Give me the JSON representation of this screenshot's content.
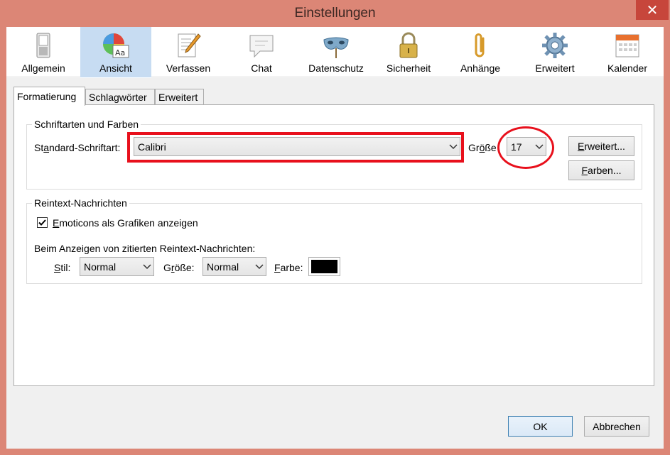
{
  "window": {
    "title": "Einstellungen",
    "close_symbol": "✕",
    "accent_color": "#dc8676"
  },
  "toolbar": {
    "items": [
      {
        "label": "Allgemein",
        "icon": "switch-icon"
      },
      {
        "label": "Ansicht",
        "icon": "palette-font-icon",
        "selected": true
      },
      {
        "label": "Verfassen",
        "icon": "compose-icon"
      },
      {
        "label": "Chat",
        "icon": "chat-bubble-icon"
      },
      {
        "label": "Datenschutz",
        "icon": "mask-icon"
      },
      {
        "label": "Sicherheit",
        "icon": "padlock-icon"
      },
      {
        "label": "Anhänge",
        "icon": "paperclip-icon"
      },
      {
        "label": "Erweitert",
        "icon": "gear-icon"
      },
      {
        "label": "Kalender",
        "icon": "calendar-icon"
      }
    ]
  },
  "tabs": [
    {
      "label": "Formatierung",
      "active": true
    },
    {
      "label": "Schlagwörter"
    },
    {
      "label": "Erweitert"
    }
  ],
  "fonts_group": {
    "title": "Schriftarten und Farben",
    "default_font_label": "Standard-Schriftart:",
    "default_font_value": "Calibri",
    "size_label": "Größe",
    "size_value": "17",
    "advanced_button": "Erweitert...",
    "colors_button": "Farben..."
  },
  "plaintext_group": {
    "title": "Reintext-Nachrichten",
    "emoticons_label": "Emoticons als Grafiken anzeigen",
    "emoticons_checked": true,
    "quoted_label": "Beim Anzeigen von zitierten Reintext-Nachrichten:",
    "style_label": "Stil:",
    "style_value": "Normal",
    "size_label": "Größe:",
    "size_value": "Normal",
    "color_label": "Farbe:",
    "color_value": "#000000"
  },
  "footer": {
    "ok_button": "OK",
    "cancel_button": "Abbrechen"
  },
  "annotation_color": "#e8101c"
}
